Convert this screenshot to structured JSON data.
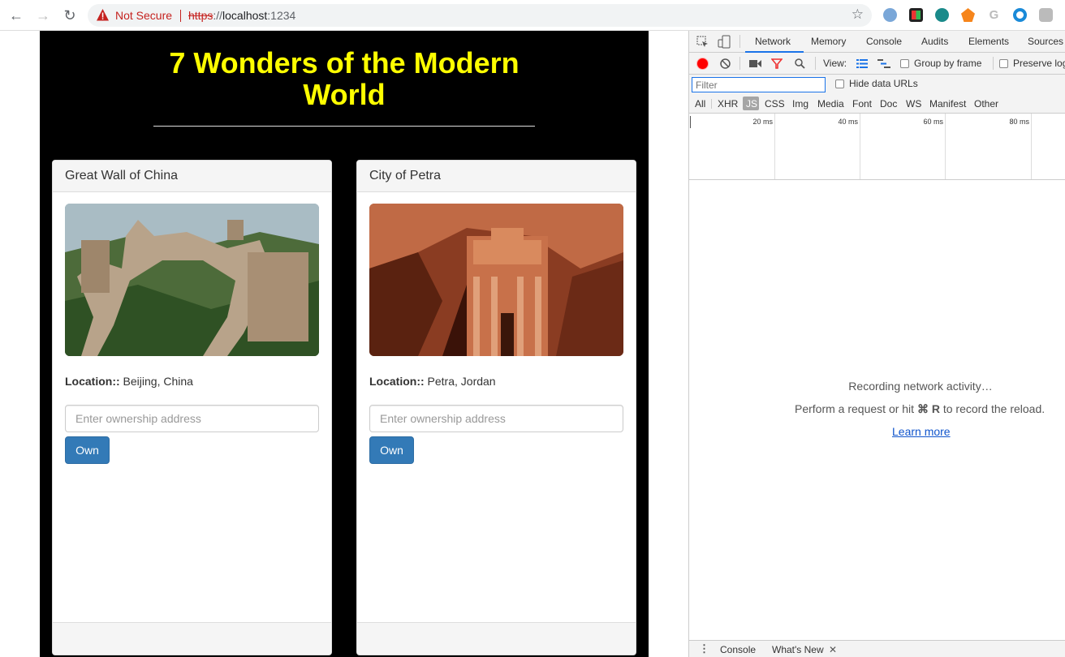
{
  "browser": {
    "security_label": "Not Secure",
    "url_scheme": "https",
    "url_sep": "://",
    "url_host": "localhost",
    "url_port": ":1234"
  },
  "page": {
    "title": "7 Wonders of the Modern World",
    "title_color": "#ffff00",
    "background": "#000000",
    "cards": [
      {
        "name": "Great Wall of China",
        "location_label": "Location::",
        "location": "Beijing, China",
        "input_placeholder": "Enter ownership address",
        "button_label": "Own"
      },
      {
        "name": "City of Petra",
        "location_label": "Location::",
        "location": "Petra, Jordan",
        "input_placeholder": "Enter ownership address",
        "button_label": "Own"
      }
    ],
    "button_color": "#337ab7"
  },
  "devtools": {
    "tabs": [
      "Network",
      "Memory",
      "Console",
      "Audits",
      "Elements",
      "Sources"
    ],
    "active_tab": "Network",
    "toolbar": {
      "view_label": "View:",
      "group_by_frame": "Group by frame",
      "preserve_log": "Preserve log"
    },
    "filter_placeholder": "Filter",
    "hide_data_urls": "Hide data URLs",
    "type_filters": [
      "All",
      "XHR",
      "JS",
      "CSS",
      "Img",
      "Media",
      "Font",
      "Doc",
      "WS",
      "Manifest",
      "Other"
    ],
    "active_type": "JS",
    "timeline_ticks": [
      "20 ms",
      "40 ms",
      "60 ms",
      "80 ms"
    ],
    "recording_text": "Recording network activity…",
    "hint_prefix": "Perform a request or hit ",
    "hint_keys": "⌘ R",
    "hint_suffix": " to record the reload.",
    "learn_more": "Learn more",
    "drawer_tabs": [
      "Console",
      "What's New"
    ]
  }
}
